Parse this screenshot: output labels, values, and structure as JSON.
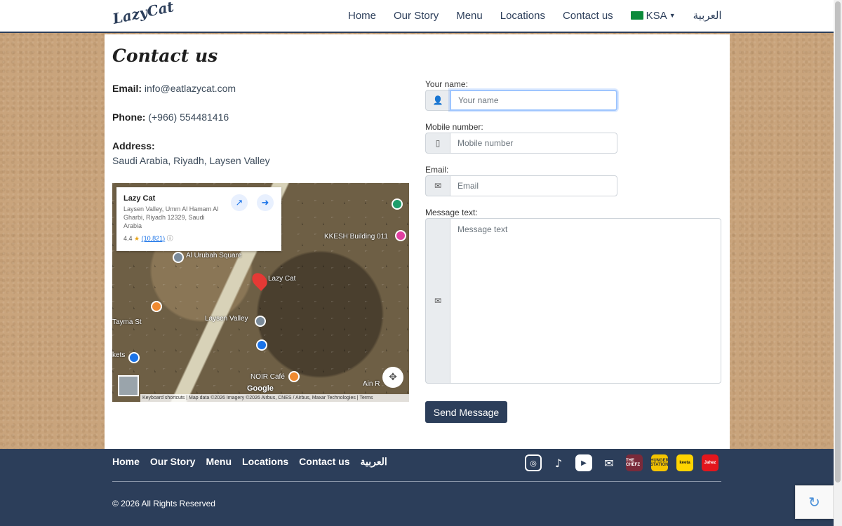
{
  "brand": {
    "logo_text": "LazyCat"
  },
  "nav": {
    "items": [
      "Home",
      "Our Story",
      "Menu",
      "Locations",
      "Contact us"
    ],
    "country": "KSA",
    "language": "العربية"
  },
  "page": {
    "title": "Contact us",
    "email_label": "Email:",
    "email_value": "info@eatlazycat.com",
    "phone_label": "Phone:",
    "phone_value": "(+966) 554481416",
    "address_label": "Address:",
    "address_value": "Saudi Arabia, Riyadh, Laysen Valley"
  },
  "map": {
    "place_name": "Lazy Cat",
    "place_address": "Laysen Valley, Umm Al Hamam Al Gharbi, Riyadh 12329, Saudi Arabia",
    "rating": "4.4",
    "review_count": "(10,821)",
    "labels": {
      "kkesh": "KKESH Building 011",
      "urubah": "Al Urubah Square",
      "lazycat": "Lazy Cat",
      "laysen": "Laysen Valley",
      "tayma": "Tayma St",
      "noir": "NOIR Café",
      "ainr": "Ain R",
      "kets": "kets"
    },
    "google": "Google",
    "footer_shortcuts": "Keyboard shortcuts",
    "footer_data": "Map data ©2026 Imagery ©2026 Airbus, CNES / Airbus, Maxar Technologies",
    "footer_terms": "Terms"
  },
  "form": {
    "name_label": "Your name:",
    "name_placeholder": "Your name",
    "mobile_label": "Mobile number:",
    "mobile_placeholder": "Mobile number",
    "email_label": "Email:",
    "email_placeholder": "Email",
    "message_label": "Message text:",
    "message_placeholder": "Message text",
    "submit": "Send Message"
  },
  "footer": {
    "nav": [
      "Home",
      "Our Story",
      "Menu",
      "Locations",
      "Contact us",
      "العربية"
    ],
    "apps": [
      "THE CHEFZ",
      "HUNGER STATION",
      "keeta",
      "Jahez"
    ],
    "copyright": "© 2026 All Rights Reserved"
  },
  "colors": {
    "primary": "#2c3e5a",
    "map_pin": "#e53935"
  }
}
